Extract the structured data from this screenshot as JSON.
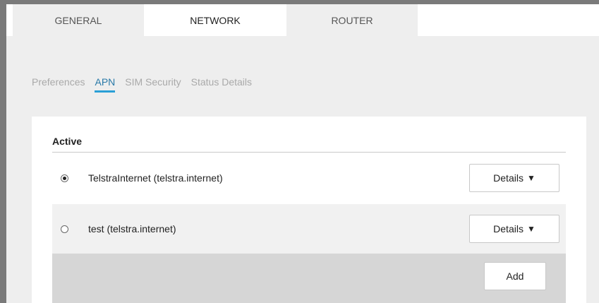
{
  "tabs": {
    "general": "GENERAL",
    "network": "NETWORK",
    "router": "ROUTER",
    "active": "network"
  },
  "subnav": {
    "items": [
      "Preferences",
      "APN",
      "SIM Security",
      "Status Details"
    ],
    "active": "APN"
  },
  "apn_section": {
    "title": "Active",
    "profiles": [
      {
        "label": "TelstraInternet (telstra.internet)",
        "selected": true,
        "button": "Details"
      },
      {
        "label": "test (telstra.internet)",
        "selected": false,
        "button": "Details"
      }
    ],
    "add_label": "Add"
  },
  "colors": {
    "accent_underline": "#2a9fd6",
    "frame": "#7a7a7a",
    "content_bg": "#eeeeee",
    "add_bar_bg": "#d6d6d6"
  },
  "icons": {
    "caret": "caret-down-icon"
  }
}
